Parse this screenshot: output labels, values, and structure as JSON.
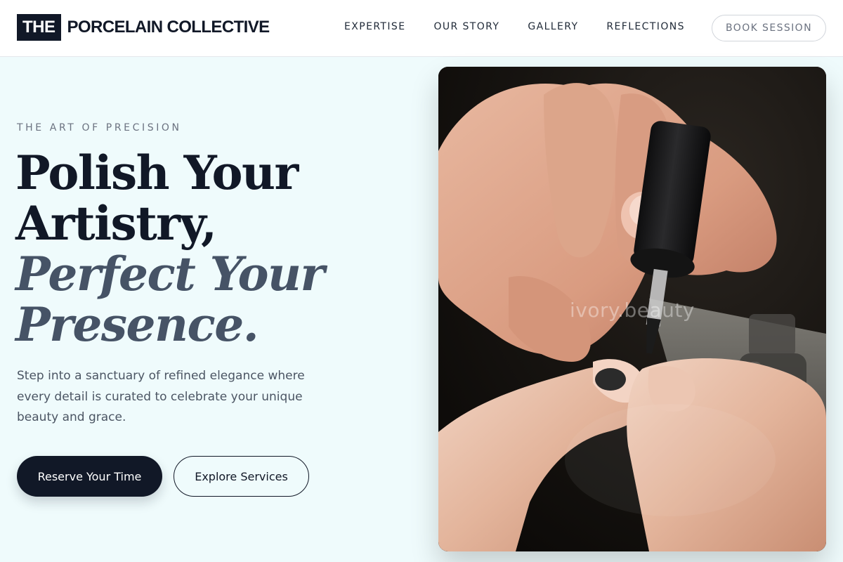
{
  "header": {
    "logo_badge": "THE",
    "logo_text": "PORCELAIN COLLECTIVE",
    "nav": [
      {
        "label": "EXPERTISE"
      },
      {
        "label": "OUR STORY"
      },
      {
        "label": "GALLERY"
      },
      {
        "label": "REFLECTIONS"
      }
    ],
    "cta_label": "BOOK SESSION"
  },
  "hero": {
    "eyebrow": "THE ART OF PRECISION",
    "headline_line1": "Polish Your",
    "headline_line2": "Artistry,",
    "headline_line3": "Perfect Your",
    "headline_line4": "Presence.",
    "description": "Step into a sanctuary of refined elegance where every detail is curated to celebrate your unique beauty and grace.",
    "primary_button": "Reserve Your Time",
    "secondary_button": "Explore Services",
    "image_watermark": "ivory.beauty",
    "image_subject": "hands applying nail polish with brush"
  },
  "colors": {
    "primary": "#111827",
    "accent_italic": "#465366",
    "background": "#effbfc",
    "muted": "#6b7280"
  }
}
